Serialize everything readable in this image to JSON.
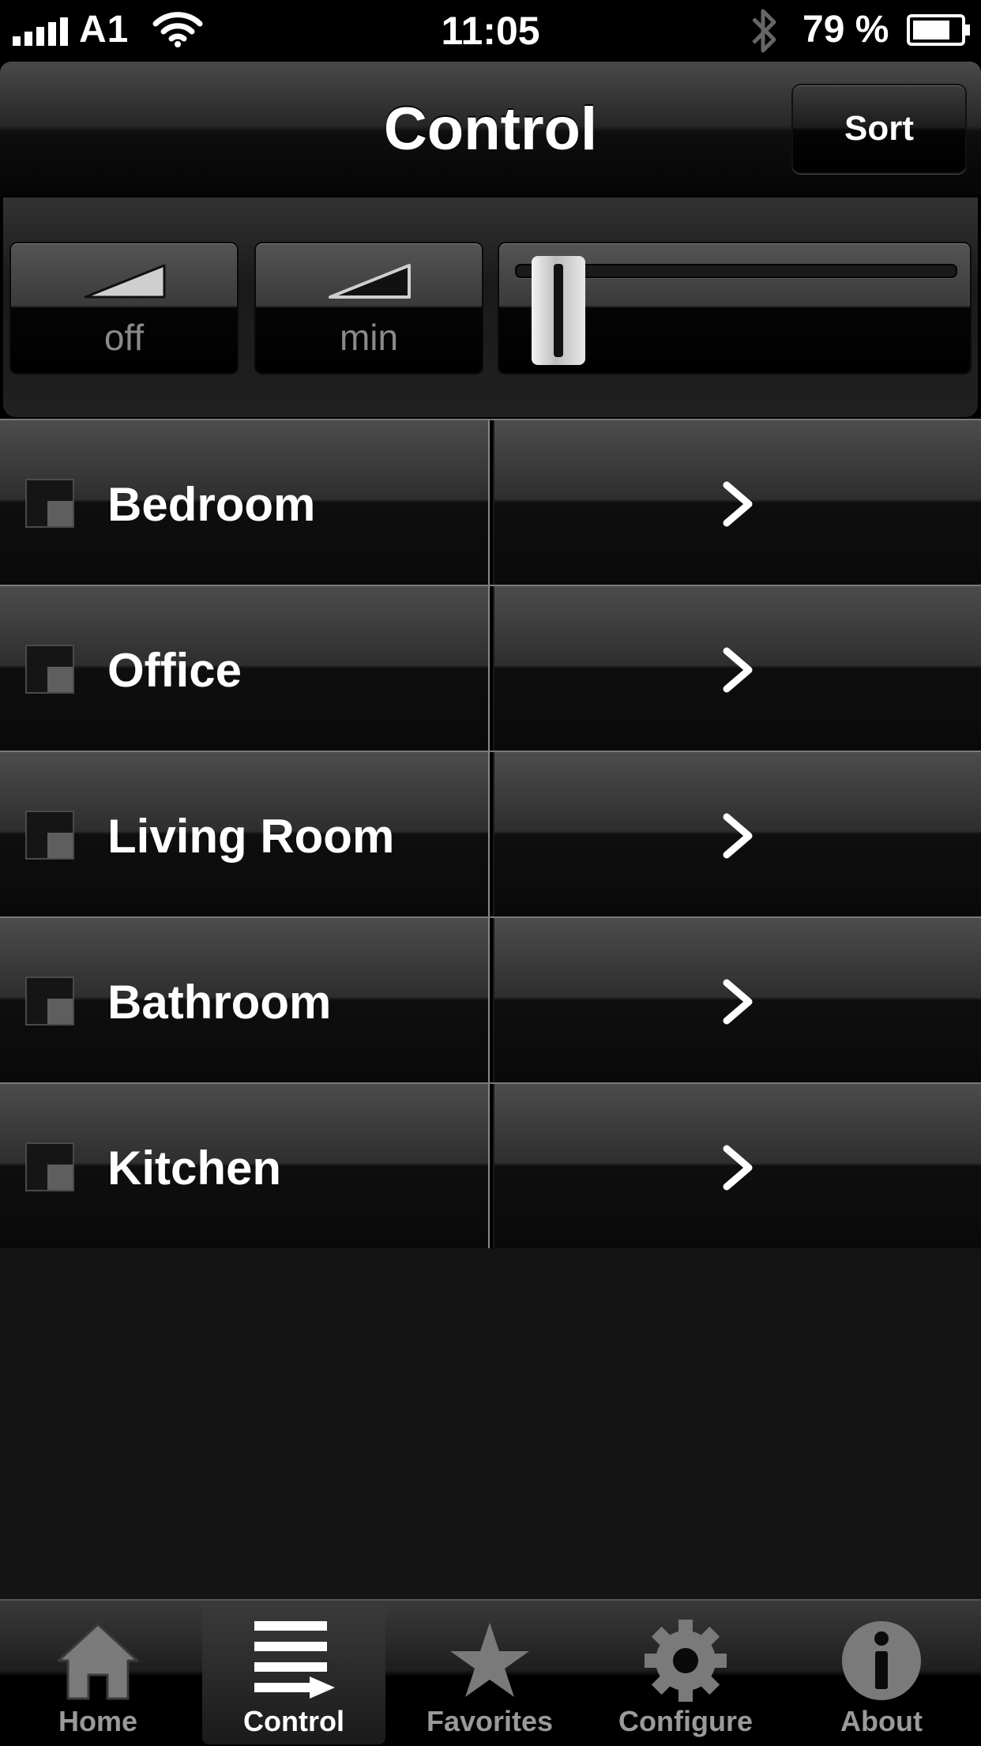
{
  "status_bar": {
    "carrier": "A1",
    "time": "11:05",
    "battery": "79 %",
    "icons": [
      "signal-icon",
      "wifi-icon",
      "bluetooth-icon",
      "battery-icon"
    ]
  },
  "nav": {
    "title": "Control",
    "sort_label": "Sort"
  },
  "dimmer": {
    "off_label": "off",
    "min_label": "min",
    "slider_level": 0.05
  },
  "rooms": [
    {
      "label": "Bedroom"
    },
    {
      "label": "Office"
    },
    {
      "label": "Living Room"
    },
    {
      "label": "Bathroom"
    },
    {
      "label": "Kitchen"
    }
  ],
  "tabs": [
    {
      "label": "Home",
      "icon": "home-icon"
    },
    {
      "label": "Control",
      "icon": "control-icon",
      "active": true
    },
    {
      "label": "Favorites",
      "icon": "star-icon"
    },
    {
      "label": "Configure",
      "icon": "gear-icon"
    },
    {
      "label": "About",
      "icon": "info-icon"
    }
  ]
}
